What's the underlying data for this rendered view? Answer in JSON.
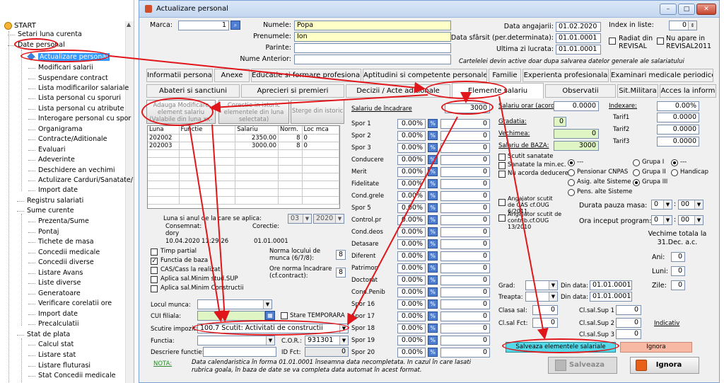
{
  "tree": {
    "root": "START",
    "items": [
      "Setari luna curenta",
      "Date personal",
      "Actualizare personal",
      "Modificari salarii",
      "Suspendare contract",
      "Lista modificarilor salariale",
      "Lista personal cu sporuri",
      "Lista personal cu atribute",
      "Interogare personal cu spor",
      "Organigrama",
      "Contracte/Aditionale",
      "Evaluari",
      "Adeverinte",
      "Deschidere an vechimi",
      "Actulizare Carduri/Sanatate/",
      "Import date",
      "Registru salariati",
      "Sume curente",
      "Prezenta/Sume",
      "Pontaj",
      "Tichete de masa",
      "Concedii medicale",
      "Concedii diverse",
      "Listare Avans",
      "Liste diverse",
      "Generatoare",
      "Verificare corelatii ore",
      "Import date",
      "Precalculatii",
      "Stat de plata",
      "Calcul stat",
      "Listare stat",
      "Listare fluturasi",
      "Stat Concedii medicale"
    ]
  },
  "window": {
    "title": "Actualizare personal",
    "min": "–",
    "max": "□",
    "close": "✕"
  },
  "header": {
    "marca_label": "Marca:",
    "marca_value": "1",
    "numele_label": "Numele:",
    "numele": "Popa",
    "prenumele_label": "Prenumele:",
    "prenumele": "Ion",
    "parinte_label": "Parinte:",
    "parinte": "",
    "numeant_label": "Nume Anterior:",
    "numeant": "",
    "data_ang_label": "Data angajarii:",
    "data_ang": "01.02.2020",
    "data_sf_label": "Data sfârsit (per.determinata):",
    "data_sf": "01.01.0001",
    "ultima_label": "Ultima zi lucrata:",
    "ultima": "01.01.0001",
    "index_label": "Index in liste:",
    "index": "0",
    "radiat_label": "Radiat din REVISAL",
    "nuapare_label": "Nu apare in REVISAL2011",
    "note": "Cartelelei devin active doar dupa salvarea datelor generale ale salariatului"
  },
  "tabs_row1": [
    "Informatii personale",
    "Anexe",
    "Educatie si formare profesionala",
    "Aptitudini si competente personale",
    "Familie",
    "Experienta profesionala",
    "Examinari medicale periodice"
  ],
  "tabs_row2": [
    "Abateri si sanctiuni",
    "Aprecieri si premieri",
    "Decizii / Acte aditionale",
    "Elemente salariu",
    "Observatii",
    "Sit.Militara",
    "Acces la inform"
  ],
  "left": {
    "btn_adauga": "Adauga Modificare element salariu (Valabile din luna xx-xxxxx)",
    "btn_corectie": "Corectie in istoric elementele din luna selectata)",
    "btn_sterge": "Sterge din istoric",
    "grid_headers": [
      "Luna",
      "Functie",
      "Salariu",
      "Norm.",
      "Loc mca"
    ],
    "grid_rows": [
      [
        "202002",
        "",
        "2350.00",
        "8",
        "0"
      ],
      [
        "202003",
        "",
        "3000.00",
        "8",
        "0"
      ]
    ],
    "luna_label": "Luna si anul de la care se aplica:",
    "luna": "03",
    "an": "2020",
    "consemnat_label": "Consemnat:",
    "consemnat_user": "dory",
    "consemnat_data": "10.04.2020",
    "consemnat_ora": "11:29:26",
    "corectie_label": "Corectie:",
    "corectie_data": "01.01.0001",
    "timp_partial": "Timp partial",
    "functia_baza": "Functia de baza",
    "cas_cass": "CAS/Cass la realizat",
    "aplica_sup": "Aplica sal.Minim stud.SUP",
    "aplica_constr": "Aplica sal.Minim Constructii",
    "norma_label": "Norma locului de munca (6/7/8):",
    "norma": "8",
    "ore_label": "Ore norma încadrare (cf.contract):",
    "ore": "8",
    "locul_label": "Locul munca:",
    "cui_label": "CUI filiala:",
    "stare_label": "Stare TEMPORARA",
    "scutire_label": "Scutire impozit:",
    "scutire": "100.7 Scutit: Activitati de constructii",
    "functia_label": "Functia:",
    "cor_label": "C.O.R.:",
    "cor": "931301",
    "descr_label": "Descriere functie:",
    "idfct_label": "ID Fct:",
    "idfct": "0",
    "nota_label": "NOTA:",
    "nota": "Data calendaristica în forma 01.01.0001 înseamna data necompletata. In cazul în care lasati rubrica goala, în baza de date se va completa data automat în acest format."
  },
  "middle": {
    "sal_label": "Salariu de încadrare",
    "sal_value": "3000",
    "sporuri": [
      [
        "Spor 1",
        "0.00%",
        "0"
      ],
      [
        "Spor 2",
        "0.00%",
        "0"
      ],
      [
        "Spor 3",
        "0.00%",
        "0"
      ],
      [
        "Conducere",
        "0.00%",
        "0"
      ],
      [
        "Merit",
        "0.00%",
        "0"
      ],
      [
        "Fidelitate",
        "0.00%",
        "0"
      ],
      [
        "Cond.grele",
        "0.00%",
        "0"
      ],
      [
        "Spor 5",
        "0.00%",
        "0"
      ],
      [
        "Control.pr",
        "0.00%",
        "0"
      ],
      [
        "Cond.deos",
        "0.00%",
        "0"
      ],
      [
        "Detasare",
        "0.00%",
        "0"
      ],
      [
        "Diferent",
        "0.00%",
        "0"
      ],
      [
        "Patrimon",
        "0.00%",
        "0"
      ],
      [
        "Doctorat",
        "0.00%",
        "0"
      ],
      [
        "Cond.Penib",
        "0.00%",
        "0"
      ],
      [
        "Spor 16",
        "0.00%",
        "0"
      ],
      [
        "Spor 17",
        "0.00%",
        "0"
      ],
      [
        "Spor 18",
        "0.00%",
        "0"
      ],
      [
        "Spor 19",
        "0.00%",
        "0"
      ],
      [
        "Spor 20",
        "0.00%",
        "0"
      ]
    ],
    "pct_btn": "%"
  },
  "right": {
    "salorar_label": "Salariu orar (acord):",
    "salorar": "0.0000",
    "indexare_label": "Indexare:",
    "indexare": "0.00%",
    "tarif1_label": "Tarif1",
    "tarif1": "0.0000",
    "tarif2_label": "Tarif2",
    "tarif2": "0.0000",
    "tarif3_label": "Tarif3",
    "tarif3": "0.0000",
    "gradatia_label": "Gradatia:",
    "gradatia": "0",
    "vechimea_label": "Vechimea:",
    "vechimea": "0",
    "salbaza_label": "Salariu de BAZA:",
    "salbaza": "3000",
    "scutit_sanatate": "Scutit sanatate",
    "sanatate_min": "Sanatate la min.ec.",
    "nu_acorda": "Nu acorda deducere",
    "radio_none": "---",
    "pens_cnpas": "Pensionar CNPAS",
    "asig_alte": "Asig. alte Sisteme",
    "pens_alte": "Pens. alte Sisteme",
    "grupa1": "Grupa I",
    "grupa2": "Grupa II",
    "grupa3": "Grupa III",
    "radio_none2": "---",
    "handicap": "Handicap",
    "angajator1": "Angajator scutit de CAS cf.OUG 6/2011",
    "angajator2": "Angajator scutit de contrib.cf.OUG 13/2010",
    "pauza_label": "Durata pauza masa:",
    "pauza_h": "0",
    "pauza_m": "00",
    "ora_label": "Ora inceput program:",
    "ora_h": "0",
    "ora_m": "00",
    "vechime_total_label": "Vechime totala la 31.Dec. a.c.",
    "ani_label": "Ani:",
    "ani": "0",
    "luni_label": "Luni:",
    "luni": "0",
    "zile_label": "Zile:",
    "zile": "0",
    "grad_label": "Grad:",
    "treapta_label": "Treapta:",
    "dindata_label": "Din data:",
    "grad_data": "01.01.0001",
    "treapta_data": "01.01.0001",
    "clasa_label": "Clasa sal:",
    "clasa": "0",
    "clfct_label": "Cl.sal Fct:",
    "clfct": "0",
    "sup1_label": "Cl.sal.Sup 1",
    "sup1": "0",
    "sup2_label": "Cl.sal.Sup 2",
    "sup2": "0",
    "sup3_label": "Cl.sal.Sup 3",
    "sup3": "0",
    "indicativ_label": "Indicativ",
    "salveaza_elem": "Salveaza elementele salariale",
    "ignora_small": "Ignora",
    "salveaza": "Salveaza",
    "ignora": "Ignora"
  }
}
